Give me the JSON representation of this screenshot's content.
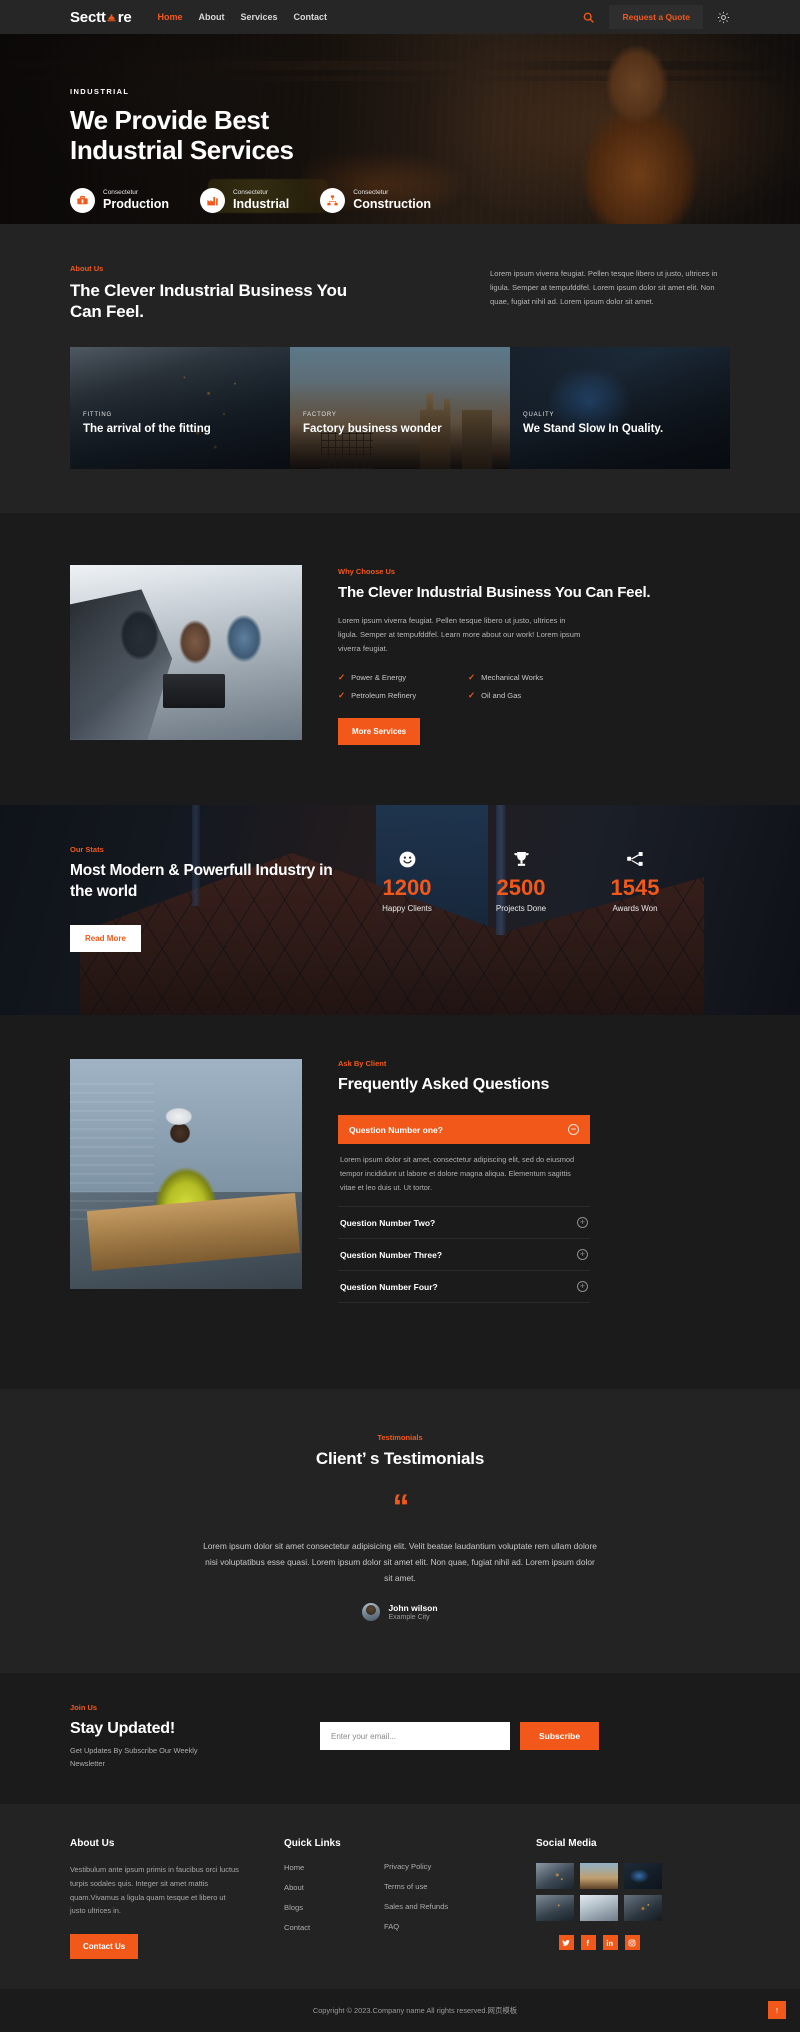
{
  "header": {
    "logo_text_1": "Sectt",
    "logo_text_2": "re",
    "nav": [
      {
        "label": "Home",
        "active": true
      },
      {
        "label": "About",
        "active": false
      },
      {
        "label": "Services",
        "active": false
      },
      {
        "label": "Contact",
        "active": false
      }
    ],
    "quote_button": "Request a Quote",
    "icons": {
      "search": "search-icon",
      "theme": "sun-icon"
    }
  },
  "hero": {
    "eyebrow": "INDUSTRIAL",
    "title_line1": "We Provide Best",
    "title_line2": "Industrial Services",
    "badges": [
      {
        "sub": "Consectetur",
        "title": "Production",
        "icon": "toolbox-icon"
      },
      {
        "sub": "Consectetur",
        "title": "Industrial",
        "icon": "factory-icon"
      },
      {
        "sub": "Consectetur",
        "title": "Construction",
        "icon": "sitemap-icon"
      }
    ]
  },
  "about": {
    "kicker": "About Us",
    "heading": "The Clever Industrial Business You Can Feel.",
    "paragraph": "Lorem ipsum viverra feugiat. Pellen tesque libero ut justo, ultrices in ligula. Semper at tempufddfel. Lorem ipsum dolor sit amet elit. Non quae, fugiat nihil ad. Lorem ipsum dolor sit amet.",
    "cards": [
      {
        "tag": "FITTING",
        "title": "The arrival of the fitting"
      },
      {
        "tag": "FACTORY",
        "title": "Factory business wonder"
      },
      {
        "tag": "QUALITY",
        "title": "We Stand Slow In Quality."
      }
    ]
  },
  "why": {
    "kicker": "Why Choose Us",
    "heading": "The Clever Industrial Business You Can Feel.",
    "paragraph": "Lorem ipsum viverra feugiat. Pellen tesque libero ut justo, ultrices in ligula. Semper at tempufddfel. Learn more about our work! Lorem ipsum viverra feugiat.",
    "checks": [
      "Power & Energy",
      "Mechanical Works",
      "Petroleum Refinery",
      "Oil and Gas"
    ],
    "button": "More Services",
    "image_alt": "team-engineers-laptop-photo"
  },
  "stats": {
    "kicker": "Our Stats",
    "heading": "Most Modern & Powerfull Industry in the world",
    "button": "Read More",
    "items": [
      {
        "icon": "smiley-icon",
        "value": "1200",
        "label": "Happy Clients"
      },
      {
        "icon": "trophy-icon",
        "value": "2500",
        "label": "Projects Done"
      },
      {
        "icon": "network-icon",
        "value": "1545",
        "label": "Awards Won"
      }
    ]
  },
  "faq": {
    "kicker": "Ask By Client",
    "heading": "Frequently Asked Questions",
    "open_question": "Question Number one?",
    "open_answer": "Lorem ipsum dolor sit amet, consectetur adipiscing elit, sed do eiusmod tempor incididunt ut labore et dolore magna aliqua. Elementum sagittis vitae et leo duis ut. Ut tortor.",
    "questions": [
      "Question Number Two?",
      "Question Number Three?",
      "Question Number Four?"
    ],
    "image_alt": "worker-carrying-lumber-photo"
  },
  "testimonials": {
    "kicker": "Testimonials",
    "heading": "Client’ s Testimonials",
    "quote_glyph": "“",
    "quote": "Lorem ipsum dolor sit amet consectetur adipisicing elit. Velit beatae laudantium voluptate rem ullam dolore nisi voluptatibus esse quasi. Lorem ipsum dolor sit amet elit. Non quae, fugiat nihil ad. Lorem ipsum dolor sit amet.",
    "author_name": "John wilson",
    "author_city": "Example City"
  },
  "newsletter": {
    "kicker": "Join Us",
    "heading": "Stay Updated!",
    "subtext": "Get Updates By Subscribe Our Weekly Newsletter",
    "input_placeholder": "Enter your email...",
    "input_value": "",
    "button": "Subscribe"
  },
  "footer": {
    "about_title": "About Us",
    "about_text": "Vestibulum ante ipsum primis in faucibus orci luctus turpis sodales quis. Integer sit amet mattis quam.Vivamus a ligula quam tesque et libero ut justo ultrices in.",
    "contact_button": "Contact Us",
    "links_title": "Quick Links",
    "links_col1": [
      "Home",
      "About",
      "Blogs",
      "Contact"
    ],
    "links_col2": [
      "Privacy Policy",
      "Terms of use",
      "Sales and Refunds",
      "FAQ"
    ],
    "social_title": "Social Media",
    "social_icons": [
      "twitter-icon",
      "facebook-icon",
      "linkedin-icon",
      "instagram-icon"
    ],
    "thumbnails": [
      "welding-thumb",
      "factory-thumb",
      "machine-thumb",
      "worker-thumb",
      "team-thumb",
      "sparks-thumb"
    ]
  },
  "copyright": {
    "text": "Copyright © 2023.Company name All rights reserved.网页模板",
    "to_top": "↑"
  },
  "colors": {
    "accent": "#f2581a",
    "bg_dark": "#1b1b1b",
    "bg_panel": "#232323",
    "header": "#262626"
  }
}
